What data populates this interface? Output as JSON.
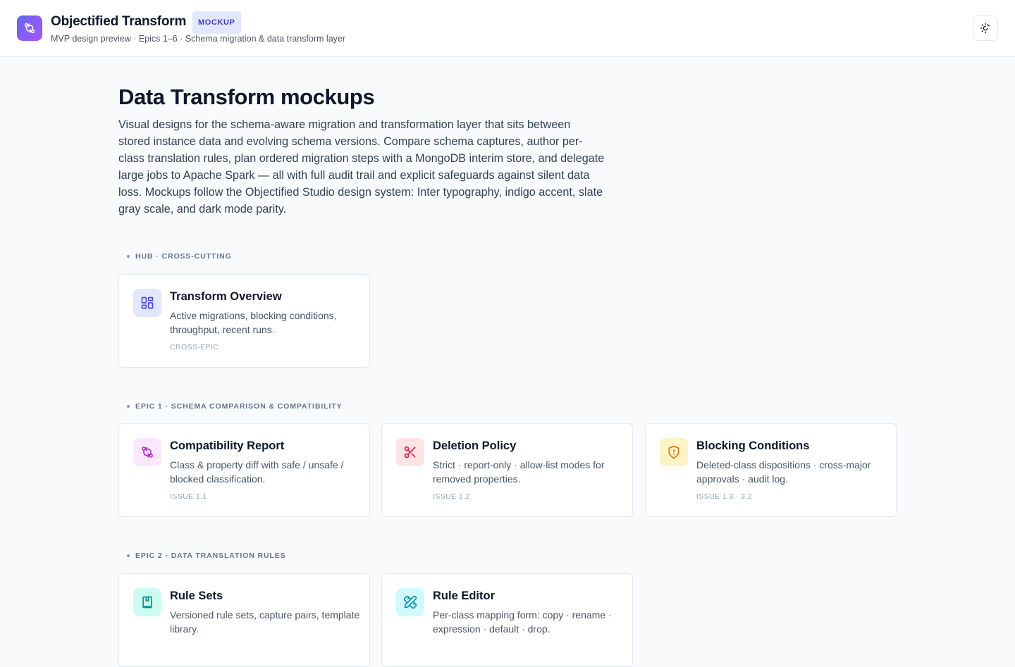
{
  "header": {
    "app_title": "Objectified Transform",
    "badge": "MOCKUP",
    "subtitle": "MVP design preview · Epics 1–6 · Schema migration & data transform layer",
    "logo_icon": "git-compare-icon",
    "theme_toggle_icon": "sun-moon-icon"
  },
  "main": {
    "title": "Data Transform mockups",
    "intro": "Visual designs for the schema-aware migration and transformation layer that sits between stored instance data and evolving schema versions. Compare schema captures, author per-class translation rules, plan ordered migration steps with a MongoDB interim store, and delegate large jobs to Apache Spark — all with full audit trail and explicit safeguards against silent data loss. Mockups follow the Objectified Studio design system: Inter typography, indigo accent, slate gray scale, and dark mode parity."
  },
  "sections": [
    {
      "label": "HUB · CROSS-CUTTING",
      "cards": [
        {
          "title": "Transform Overview",
          "desc": "Active migrations, blocking conditions, throughput, recent runs.",
          "tag": "CROSS-EPIC",
          "icon": "layout-grid-icon",
          "icon_bg": "#e0e7ff",
          "icon_color": "#4f46e5"
        }
      ]
    },
    {
      "label": "EPIC 1 · SCHEMA COMPARISON & COMPATIBILITY",
      "cards": [
        {
          "title": "Compatibility Report",
          "desc": "Class & property diff with safe / unsafe / blocked classification.",
          "tag": "ISSUE 1.1",
          "icon": "git-compare-icon",
          "icon_bg": "#fae8ff",
          "icon_color": "#c026d3"
        },
        {
          "title": "Deletion Policy",
          "desc": "Strict · report-only · allow-list modes for removed properties.",
          "tag": "ISSUE 1.2",
          "icon": "scissors-icon",
          "icon_bg": "#ffe4e6",
          "icon_color": "#e11d48"
        },
        {
          "title": "Blocking Conditions",
          "desc": "Deleted-class dispositions · cross-major approvals · audit log.",
          "tag": "ISSUE 1.3 · 3.2",
          "icon": "shield-alert-icon",
          "icon_bg": "#fef3c7",
          "icon_color": "#d97706"
        }
      ]
    },
    {
      "label": "EPIC 2 · DATA TRANSLATION RULES",
      "cards": [
        {
          "title": "Rule Sets",
          "desc": "Versioned rule sets, capture pairs, template library.",
          "tag": "",
          "icon": "book-icon",
          "icon_bg": "#ccfbf1",
          "icon_color": "#0d9488"
        },
        {
          "title": "Rule Editor",
          "desc": "Per-class mapping form: copy · rename · expression · default · drop.",
          "tag": "",
          "icon": "pencil-ruler-icon",
          "icon_bg": "#cffafe",
          "icon_color": "#0891b2"
        }
      ]
    }
  ]
}
